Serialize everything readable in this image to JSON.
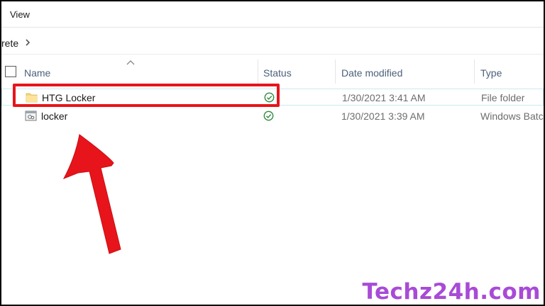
{
  "ribbon": {
    "tab_view": "View"
  },
  "address": {
    "crumb": "rete"
  },
  "columns": {
    "name": "Name",
    "status": "Status",
    "date_modified": "Date modified",
    "type": "Type"
  },
  "files": [
    {
      "name": "HTG Locker",
      "icon": "folder-icon",
      "status": "synced",
      "date": "1/30/2021 3:41 AM",
      "type": "File folder"
    },
    {
      "name": "locker",
      "icon": "batch-file-icon",
      "status": "synced",
      "date": "1/30/2021 3:39 AM",
      "type": "Windows Batc"
    }
  ],
  "annotation": {
    "highlight_color": "#e8141b",
    "arrow_color": "#e8141b"
  },
  "watermark": {
    "text": "Techz24h.com",
    "color": "#a84bd6"
  }
}
